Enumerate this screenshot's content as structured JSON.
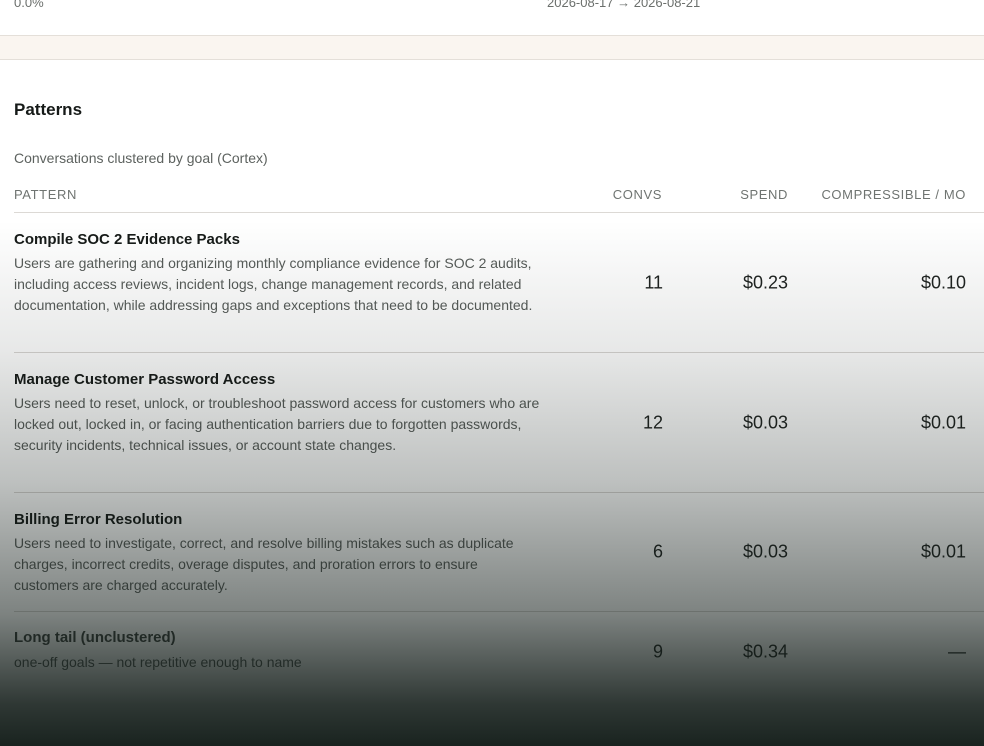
{
  "summary": {
    "percent": "0.0%",
    "date_range": "2026-08-17 → 2026-08-21"
  },
  "patterns": {
    "title": "Patterns",
    "subtitle": "Conversations clustered by goal (Cortex)",
    "columns": {
      "pattern": "PATTERN",
      "convs": "CONVS",
      "spend": "SPEND",
      "compressible": "COMPRESSIBLE / MO"
    },
    "rows": [
      {
        "name": "Compile SOC 2 Evidence Packs",
        "description": "Users are gathering and organizing monthly compliance evidence for SOC 2 audits, including access reviews, incident logs, change management records, and related documentation, while addressing gaps and exceptions that need to be documented.",
        "convs": "11",
        "spend": "$0.23",
        "compressible": "$0.10"
      },
      {
        "name": "Manage Customer Password Access",
        "description": "Users need to reset, unlock, or troubleshoot password access for customers who are locked out, locked in, or facing authentication barriers due to forgotten passwords, security incidents, technical issues, or account state changes.",
        "convs": "12",
        "spend": "$0.03",
        "compressible": "$0.01"
      },
      {
        "name": "Billing Error Resolution",
        "description": "Users need to investigate, correct, and resolve billing mistakes such as duplicate charges, incorrect credits, overage disputes, and proration errors to ensure customers are charged accurately.",
        "convs": "6",
        "spend": "$0.03",
        "compressible": "$0.01"
      },
      {
        "name": "Long tail (unclustered)",
        "description": "one-off goals — not repetitive enough to name",
        "convs": "9",
        "spend": "$0.34",
        "compressible": "—"
      }
    ]
  }
}
